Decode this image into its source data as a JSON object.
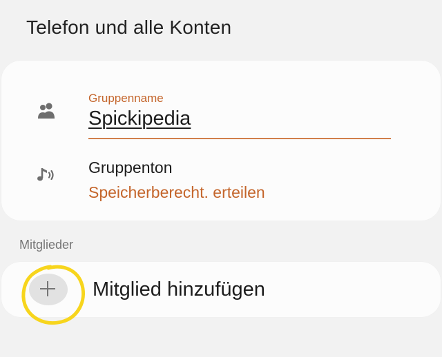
{
  "header": {
    "account": "Telefon und alle Konten"
  },
  "group": {
    "name_label": "Gruppenname",
    "name_value": "Spickipedia",
    "tone_label": "Gruppenton",
    "tone_action": "Speicherberecht. erteilen"
  },
  "members": {
    "section_label": "Mitglieder",
    "add_label": "Mitglied hinzufügen",
    "add_symbol": "+"
  },
  "icons": {
    "group": "people-icon",
    "tone": "music-note-icon",
    "add": "plus-icon"
  },
  "colors": {
    "accent": "#c4652b",
    "annotation": "#f7d51d"
  }
}
